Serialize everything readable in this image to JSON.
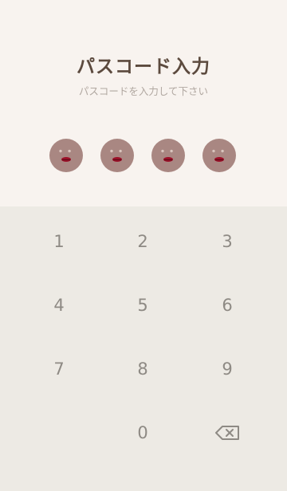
{
  "header": {
    "title": "パスコード入力",
    "subtitle": "パスコードを入力して下さい"
  },
  "passcode_dots": [
    {
      "eyes": "o o"
    },
    {
      "eyes": "o o"
    },
    {
      "eyes": "o o"
    },
    {
      "eyes": "o o"
    }
  ],
  "keypad": {
    "keys": [
      "1",
      "2",
      "3",
      "4",
      "5",
      "6",
      "7",
      "8",
      "9",
      "0"
    ],
    "backspace_icon": "backspace-icon"
  },
  "colors": {
    "top_bg": "#f8f3ef",
    "keypad_bg": "#edeae4",
    "dot": "#a98782",
    "lips": "#9b1028",
    "title": "#5c4a3e"
  }
}
